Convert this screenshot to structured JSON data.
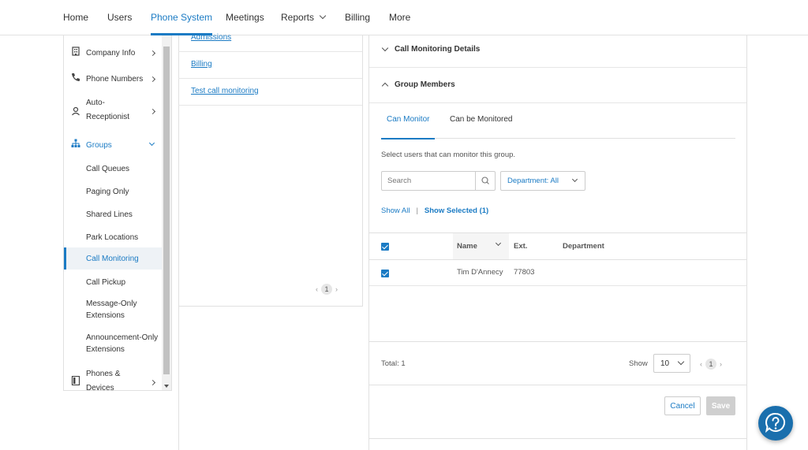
{
  "topnav": {
    "items": [
      {
        "label": "Home"
      },
      {
        "label": "Users"
      },
      {
        "label": "Phone System"
      },
      {
        "label": "Meetings"
      },
      {
        "label": "Reports"
      },
      {
        "label": "Billing"
      },
      {
        "label": "More"
      }
    ],
    "active": "Phone System"
  },
  "sidebar": {
    "company_info": "Company Info",
    "phone_numbers": "Phone Numbers",
    "auto_receptionist": [
      "Auto-",
      "Receptionist"
    ],
    "groups": "Groups",
    "call_queues": "Call Queues",
    "paging_only": "Paging Only",
    "shared_lines": "Shared Lines",
    "park_locations": "Park Locations",
    "call_monitoring": "Call Monitoring",
    "call_pickup": "Call Pickup",
    "message_only": [
      "Message-Only",
      "Extensions"
    ],
    "announcement_only": [
      "Announcement-Only",
      "Extensions"
    ],
    "phones_devices": [
      "Phones &",
      "Devices"
    ]
  },
  "midlist": {
    "items": [
      "Admissions",
      "Billing",
      "Test call monitoring"
    ],
    "page": "1"
  },
  "details": {
    "call_monitoring_details": "Call Monitoring Details",
    "group_members": "Group Members",
    "tabs": [
      "Can Monitor",
      "Can be Monitored"
    ],
    "hint": "Select users that can monitor this group.",
    "search_placeholder": "Search",
    "department_filter": "Department: All",
    "show_all": "Show All",
    "show_selected": "Show Selected (1)",
    "table": {
      "headers": [
        "Name",
        "Ext.",
        "Department"
      ],
      "rows": [
        {
          "name": "Tim D'Annecy",
          "ext": "77803",
          "department": "",
          "checked": true
        }
      ]
    },
    "total": "Total: 1",
    "show_label": "Show",
    "page_size": "10",
    "page": "1",
    "cancel": "Cancel",
    "save": "Save"
  },
  "colors": {
    "accent": "#1b7bc4",
    "help_button": "#1a6fad"
  }
}
